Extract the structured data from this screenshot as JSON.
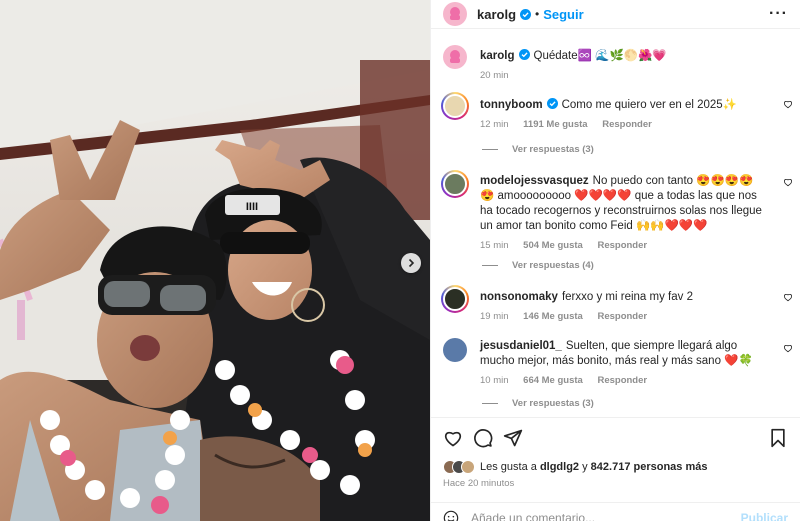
{
  "post": {
    "author": "karolg",
    "follow_label": "Seguir",
    "more_label": "···",
    "separator": "•",
    "caption": {
      "username": "karolg",
      "text": "Quédate♾️ 🌊🌿🌕🌺💗",
      "time": "20 min"
    }
  },
  "comments": [
    {
      "username": "tonnyboom",
      "verified": true,
      "text": "Como me quiero ver en el 2025✨",
      "time": "12 min",
      "likes": "1191 Me gusta",
      "reply_label": "Responder",
      "replies_label": "Ver respuestas (3)"
    },
    {
      "username": "modelojessvasquez",
      "verified": false,
      "text": "No puedo con tanto 😍😍😍😍😍 amooooooooo ❤️❤️❤️❤️ que a todas las que nos ha tocado recogernos y reconstruirnos solas nos llegue un amor tan bonito como Feid 🙌🙌❤️❤️❤️",
      "time": "15 min",
      "likes": "504 Me gusta",
      "reply_label": "Responder",
      "replies_label": "Ver respuestas (4)"
    },
    {
      "username": "nonsonomaky",
      "verified": false,
      "text": "ferxxo y mi reina my fav 2",
      "time": "19 min",
      "likes": "146 Me gusta",
      "reply_label": "Responder"
    },
    {
      "username": "jesusdaniel01_",
      "verified": false,
      "text": "Suelten, que siempre llegará algo mucho mejor, más bonito, más real y más sano ❤️🍀",
      "time": "10 min",
      "likes": "664 Me gusta",
      "reply_label": "Responder",
      "replies_label": "Ver respuestas (3)"
    }
  ],
  "likes_summary": {
    "prefix": "Les gusta a",
    "user": "dlgdlg2",
    "joiner": "y",
    "count": "842.717 personas más"
  },
  "posted_ago": "Hace 20 minutos",
  "composer": {
    "placeholder": "Añade un comentario...",
    "post_label": "Publicar"
  },
  "colors": {
    "accent": "#0095f6",
    "secondary_text": "#8e8e8e",
    "verified": "#0095f6",
    "heart_red": "#ed4956"
  },
  "icons": [
    "verified-badge-icon",
    "more-icon",
    "heart-icon",
    "comment-icon",
    "share-icon",
    "bookmark-icon",
    "emoji-icon",
    "chevron-right-icon"
  ]
}
